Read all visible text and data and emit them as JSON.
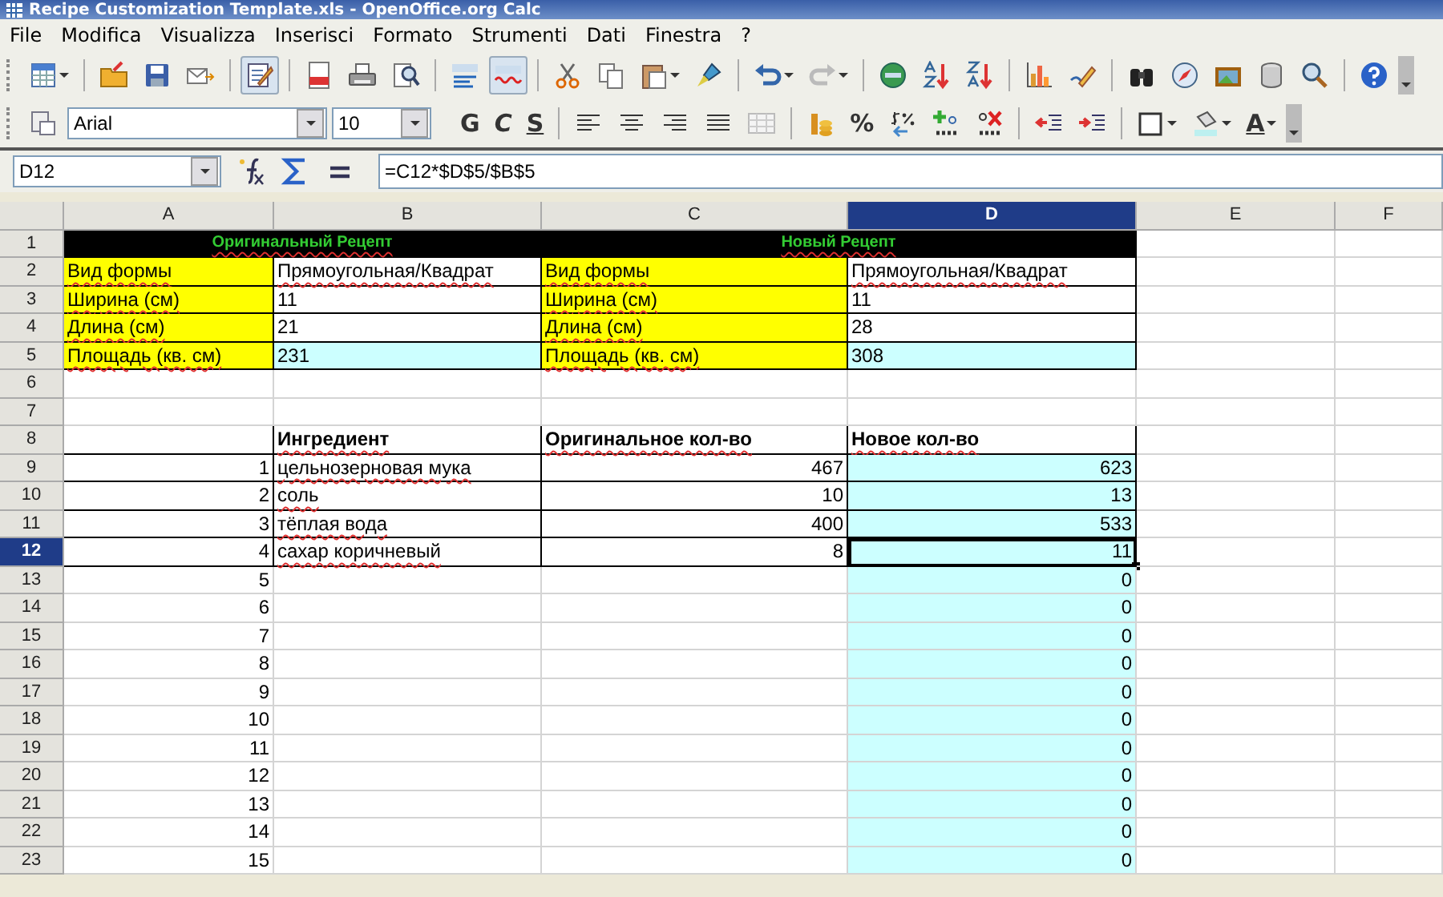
{
  "window": {
    "title": "Recipe Customization Template.xls - OpenOffice.org Calc"
  },
  "menu": [
    "File",
    "Modifica",
    "Visualizza",
    "Inserisci",
    "Formato",
    "Strumenti",
    "Dati",
    "Finestra",
    "?"
  ],
  "toolbar_standard": [
    {
      "kind": "new",
      "on": false
    },
    {
      "kind": "sep"
    },
    {
      "kind": "open",
      "on": false
    },
    {
      "kind": "save",
      "on": false
    },
    {
      "kind": "email",
      "on": false
    },
    {
      "kind": "sep"
    },
    {
      "kind": "edit",
      "on": true
    },
    {
      "kind": "sep"
    },
    {
      "kind": "pdf",
      "on": false
    },
    {
      "kind": "print",
      "on": false
    },
    {
      "kind": "preview",
      "on": false
    },
    {
      "kind": "sep"
    },
    {
      "kind": "spell",
      "on": false
    },
    {
      "kind": "autospell",
      "on": true
    },
    {
      "kind": "sep"
    },
    {
      "kind": "cut",
      "on": false
    },
    {
      "kind": "copy",
      "on": false
    },
    {
      "kind": "paste",
      "on": false
    },
    {
      "kind": "brush",
      "on": false
    },
    {
      "kind": "sep"
    },
    {
      "kind": "undo",
      "on": false
    },
    {
      "kind": "redo",
      "on": false
    },
    {
      "kind": "sep"
    },
    {
      "kind": "hyperlink",
      "on": false
    },
    {
      "kind": "sortasc",
      "on": false
    },
    {
      "kind": "sortdesc",
      "on": false
    },
    {
      "kind": "sep"
    },
    {
      "kind": "chart",
      "on": false
    },
    {
      "kind": "draw",
      "on": false
    },
    {
      "kind": "sep"
    },
    {
      "kind": "find",
      "on": false
    },
    {
      "kind": "navigator",
      "on": false
    },
    {
      "kind": "gallery",
      "on": false
    },
    {
      "kind": "database",
      "on": false
    },
    {
      "kind": "zoom",
      "on": false
    },
    {
      "kind": "sep"
    },
    {
      "kind": "help",
      "on": false
    },
    {
      "kind": "more"
    }
  ],
  "toolbar_format": [
    {
      "kind": "styles"
    },
    {
      "kind": "fontname",
      "value": "Arial"
    },
    {
      "kind": "fontsize",
      "value": "10"
    },
    {
      "kind": "bold",
      "label": "G"
    },
    {
      "kind": "italic",
      "label": "C"
    },
    {
      "kind": "underline",
      "label": "S"
    },
    {
      "kind": "sep"
    },
    {
      "kind": "alignleft"
    },
    {
      "kind": "aligncenter"
    },
    {
      "kind": "alignright"
    },
    {
      "kind": "justify"
    },
    {
      "kind": "merge"
    },
    {
      "kind": "sep"
    },
    {
      "kind": "currency"
    },
    {
      "kind": "percent",
      "label": "%"
    },
    {
      "kind": "standard"
    },
    {
      "kind": "adddecimal"
    },
    {
      "kind": "deldecimal"
    },
    {
      "kind": "sep"
    },
    {
      "kind": "outdent"
    },
    {
      "kind": "indent"
    },
    {
      "kind": "sep"
    },
    {
      "kind": "borders"
    },
    {
      "kind": "background"
    },
    {
      "kind": "fontcolor",
      "label": "A"
    },
    {
      "kind": "more"
    }
  ],
  "formula_bar": {
    "cell_reference": "D12",
    "formula": "=C12*$D$5/$B$5"
  },
  "columns": [
    {
      "label": "A",
      "selected": false
    },
    {
      "label": "B",
      "selected": false
    },
    {
      "label": "C",
      "selected": false
    },
    {
      "label": "D",
      "selected": true
    },
    {
      "label": "E",
      "selected": false
    },
    {
      "label": "F",
      "selected": false
    }
  ],
  "rows": [
    {
      "num": "1",
      "selected": false,
      "boxed": true,
      "cells": [
        {
          "kind": "title",
          "text": "Оригинальный Рецепт",
          "color": "#000000",
          "misspelled": true
        },
        {
          "kind": "title",
          "text": "Новый Рецепт",
          "color": "#000000",
          "misspelled": true
        },
        {},
        {}
      ]
    },
    {
      "num": "2",
      "selected": false,
      "boxed": true,
      "cells": [
        {
          "text": "Вид формы",
          "color": "#ffff00",
          "misspelled": true
        },
        {
          "text": "Прямоугольная/Квадрат",
          "misspelled": true
        },
        {
          "text": "Вид формы",
          "color": "#ffff00",
          "misspelled": true
        },
        {
          "text": "Прямоугольная/Квадрат",
          "misspelled": true
        },
        {},
        {}
      ]
    },
    {
      "num": "3",
      "selected": false,
      "boxed": true,
      "cells": [
        {
          "text": "Ширина (см)",
          "color": "#ffff00",
          "misspelled": true
        },
        {
          "text": "11"
        },
        {
          "text": "Ширина (см)",
          "color": "#ffff00",
          "misspelled": true
        },
        {
          "text": "11"
        },
        {},
        {}
      ]
    },
    {
      "num": "4",
      "selected": false,
      "boxed": true,
      "cells": [
        {
          "text": "Длина (см)",
          "color": "#ffff00",
          "misspelled": true
        },
        {
          "text": "21"
        },
        {
          "text": "Длина (см)",
          "color": "#ffff00",
          "misspelled": true
        },
        {
          "text": "28"
        },
        {},
        {}
      ]
    },
    {
      "num": "5",
      "selected": false,
      "boxed": true,
      "cells": [
        {
          "text": "Площадь (кв. см)",
          "color": "#ffff00",
          "misspelled": true
        },
        {
          "text": "231",
          "color": "#ccffff"
        },
        {
          "text": "Площадь (кв. см)",
          "color": "#ffff00",
          "misspelled": true
        },
        {
          "text": "308",
          "color": "#ccffff"
        },
        {},
        {}
      ]
    },
    {
      "num": "6",
      "selected": false,
      "boxed": false,
      "cells": [
        {},
        {},
        {},
        {},
        {},
        {}
      ]
    },
    {
      "num": "7",
      "selected": false,
      "boxed": false,
      "cells": [
        {},
        {},
        {},
        {},
        {},
        {}
      ]
    },
    {
      "num": "8",
      "selected": false,
      "boxed": true,
      "cells": [
        {},
        {
          "text": "Ингредиент",
          "bold": true,
          "misspelled": true
        },
        {
          "text": "Оригинальное кол-во",
          "bold": true,
          "misspelled": true
        },
        {
          "text": "Новое кол-во",
          "bold": true,
          "misspelled": true
        },
        {},
        {}
      ]
    },
    {
      "num": "9",
      "selected": false,
      "boxed": true,
      "cells": [
        {
          "kind": "number",
          "text": "1"
        },
        {
          "text": "цельнозерновая мука",
          "misspelled": true
        },
        {
          "kind": "number",
          "text": "467"
        },
        {
          "kind": "number",
          "text": "623",
          "color": "#ccffff"
        },
        {},
        {}
      ]
    },
    {
      "num": "10",
      "selected": false,
      "boxed": true,
      "cells": [
        {
          "kind": "number",
          "text": "2"
        },
        {
          "text": "соль",
          "misspelled": true
        },
        {
          "kind": "number",
          "text": "10"
        },
        {
          "kind": "number",
          "text": "13",
          "color": "#ccffff"
        },
        {},
        {}
      ]
    },
    {
      "num": "11",
      "selected": false,
      "boxed": true,
      "cells": [
        {
          "kind": "number",
          "text": "3"
        },
        {
          "text": "тёплая вода",
          "misspelled": true
        },
        {
          "kind": "number",
          "text": "400"
        },
        {
          "kind": "number",
          "text": "533",
          "color": "#ccffff"
        },
        {},
        {}
      ]
    },
    {
      "num": "12",
      "selected": true,
      "boxed": true,
      "cells": [
        {
          "kind": "number",
          "text": "4"
        },
        {
          "text": "сахар коричневый",
          "misspelled": true
        },
        {
          "kind": "number",
          "text": "8"
        },
        {
          "kind": "number",
          "text": "11",
          "color": "#ccffff",
          "selected": true
        },
        {},
        {}
      ]
    },
    {
      "num": "13",
      "selected": false,
      "boxed": false,
      "cells": [
        {
          "kind": "number",
          "text": "5"
        },
        {},
        {},
        {
          "kind": "number",
          "text": "0",
          "color": "#ccffff"
        },
        {},
        {}
      ]
    },
    {
      "num": "14",
      "selected": false,
      "boxed": false,
      "cells": [
        {
          "kind": "number",
          "text": "6"
        },
        {},
        {},
        {
          "kind": "number",
          "text": "0",
          "color": "#ccffff"
        },
        {},
        {}
      ]
    },
    {
      "num": "15",
      "selected": false,
      "boxed": false,
      "cells": [
        {
          "kind": "number",
          "text": "7"
        },
        {},
        {},
        {
          "kind": "number",
          "text": "0",
          "color": "#ccffff"
        },
        {},
        {}
      ]
    },
    {
      "num": "16",
      "selected": false,
      "boxed": false,
      "cells": [
        {
          "kind": "number",
          "text": "8"
        },
        {},
        {},
        {
          "kind": "number",
          "text": "0",
          "color": "#ccffff"
        },
        {},
        {}
      ]
    },
    {
      "num": "17",
      "selected": false,
      "boxed": false,
      "cells": [
        {
          "kind": "number",
          "text": "9"
        },
        {},
        {},
        {
          "kind": "number",
          "text": "0",
          "color": "#ccffff"
        },
        {},
        {}
      ]
    },
    {
      "num": "18",
      "selected": false,
      "boxed": false,
      "cells": [
        {
          "kind": "number",
          "text": "10"
        },
        {},
        {},
        {
          "kind": "number",
          "text": "0",
          "color": "#ccffff"
        },
        {},
        {}
      ]
    },
    {
      "num": "19",
      "selected": false,
      "boxed": false,
      "cells": [
        {
          "kind": "number",
          "text": "11"
        },
        {},
        {},
        {
          "kind": "number",
          "text": "0",
          "color": "#ccffff"
        },
        {},
        {}
      ]
    },
    {
      "num": "20",
      "selected": false,
      "boxed": false,
      "cells": [
        {
          "kind": "number",
          "text": "12"
        },
        {},
        {},
        {
          "kind": "number",
          "text": "0",
          "color": "#ccffff"
        },
        {},
        {}
      ]
    },
    {
      "num": "21",
      "selected": false,
      "boxed": false,
      "cells": [
        {
          "kind": "number",
          "text": "13"
        },
        {},
        {},
        {
          "kind": "number",
          "text": "0",
          "color": "#ccffff"
        },
        {},
        {}
      ]
    },
    {
      "num": "22",
      "selected": false,
      "boxed": false,
      "cells": [
        {
          "kind": "number",
          "text": "14"
        },
        {},
        {},
        {
          "kind": "number",
          "text": "0",
          "color": "#ccffff"
        },
        {},
        {}
      ]
    },
    {
      "num": "23",
      "selected": false,
      "boxed": false,
      "cells": [
        {
          "kind": "number",
          "text": "15"
        },
        {},
        {},
        {
          "kind": "number",
          "text": "0",
          "color": "#ccffff"
        },
        {},
        {}
      ]
    }
  ]
}
